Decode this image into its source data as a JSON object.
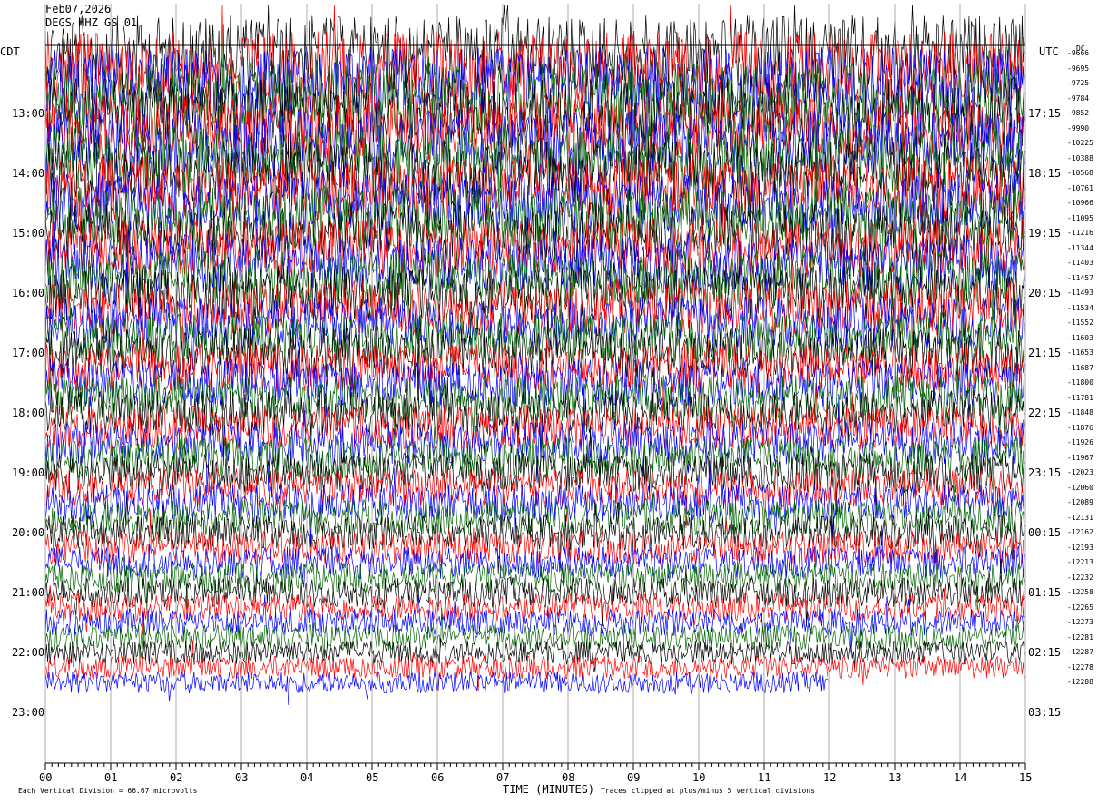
{
  "header": {
    "date": "Feb07,2026",
    "station": "DEGS HHZ GS 01"
  },
  "chart_data": {
    "type": "line",
    "title": "Feb07,2026",
    "subtitle": "DEGS HHZ GS 01",
    "xlabel": "TIME (MINUTES)",
    "x_ticks": [
      "00",
      "01",
      "02",
      "03",
      "04",
      "05",
      "06",
      "07",
      "08",
      "09",
      "10",
      "11",
      "12",
      "13",
      "14",
      "15"
    ],
    "xlim": [
      0,
      15
    ],
    "left_axis_label": "CDT",
    "right_axis_label": "UTC",
    "dc_label": "DC",
    "left_hours": [
      "13:00",
      "14:00",
      "15:00",
      "16:00",
      "17:00",
      "18:00",
      "19:00",
      "20:00",
      "21:00",
      "22:00",
      "23:00"
    ],
    "right_hours": [
      "17:15",
      "18:15",
      "19:15",
      "20:15",
      "21:15",
      "22:15",
      "23:15",
      "00:15",
      "01:15",
      "02:15",
      "03:15"
    ],
    "trace_colors": [
      "#000000",
      "#ff0000",
      "#0000ff",
      "#006600"
    ],
    "traces_per_hour": 4,
    "trace_count": 43,
    "last_trace_end_minute": 12.0,
    "dc_offsets_readable": [
      "-9666",
      "-9695",
      "-9725",
      "-9784",
      "-9852",
      "-9990",
      "-10225",
      "-10388",
      "-10568",
      "-10761",
      "-10966",
      "-11095",
      "-11216",
      "-11344",
      "-11403",
      "-11457",
      "-11493",
      "-11534",
      "-11552",
      "-11603",
      "-11653",
      "-11687",
      "-11800",
      "-11781",
      "-11848",
      "-11876",
      "-11926",
      "-11967",
      "-12023",
      "-12060",
      "-12089",
      "-12131",
      "-12162",
      "-12193",
      "-12213",
      "-12232",
      "-12258",
      "-12265",
      "-12273",
      "-12281",
      "-12287",
      "-12278",
      "-12288"
    ],
    "footer_left": "Each Vertical Division =   66.67 microvolts",
    "footer_right": "Traces clipped at plus/minus 5 vertical divisions",
    "grid": true,
    "legend": "none"
  }
}
